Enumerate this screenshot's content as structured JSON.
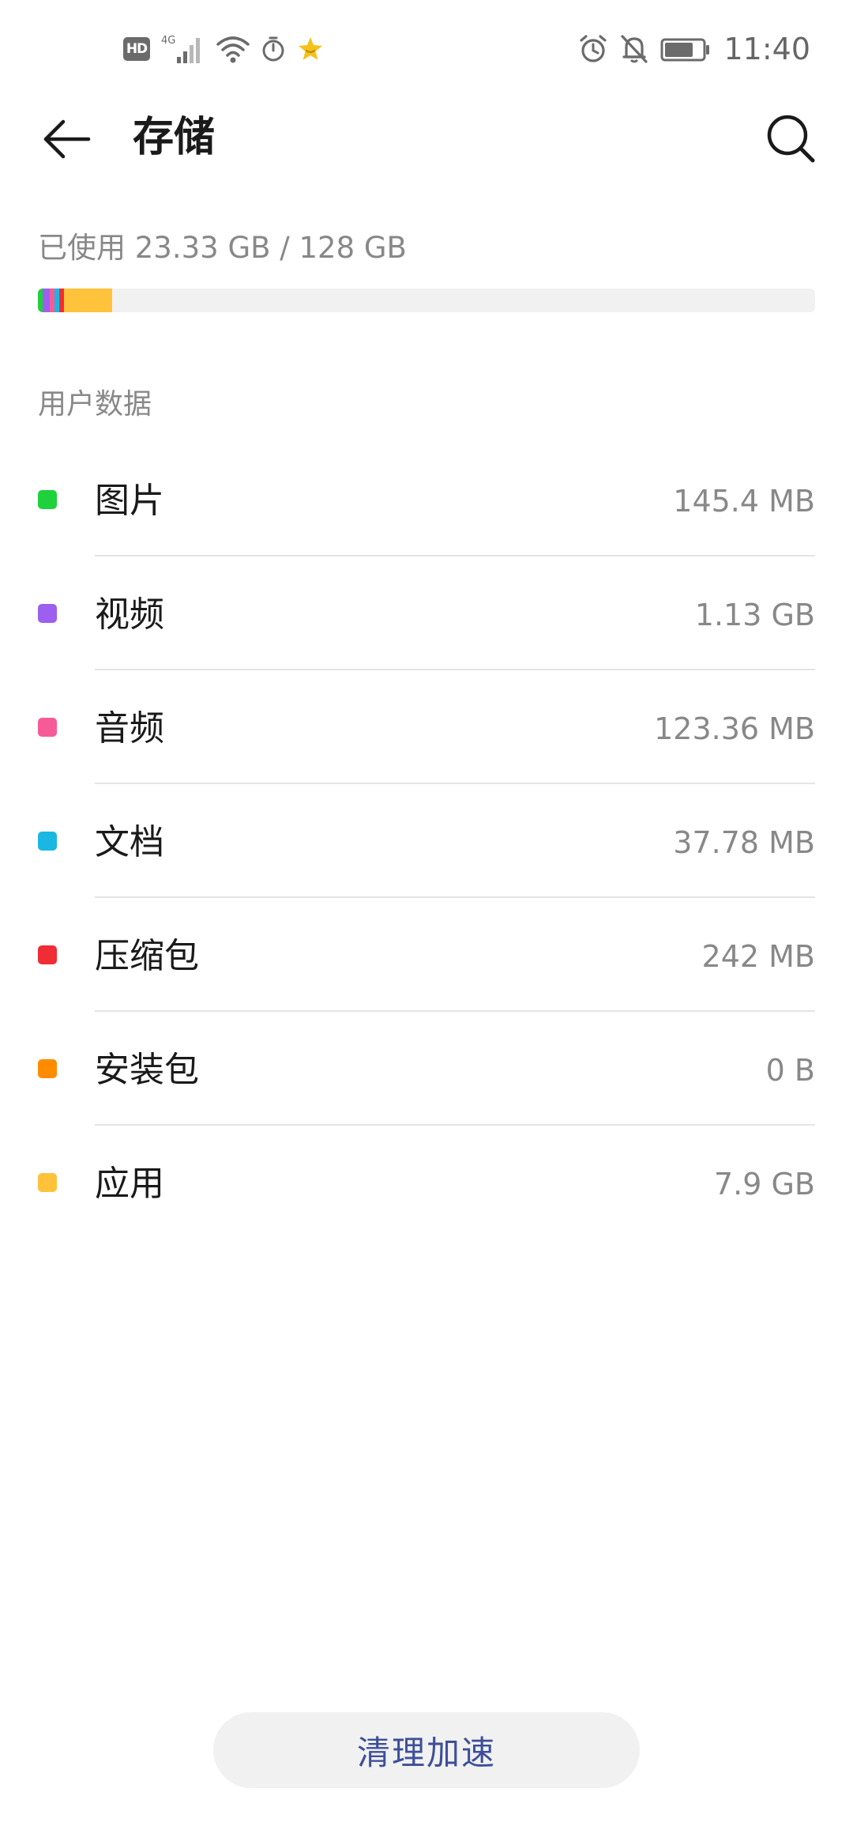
{
  "status_bar": {
    "hd_label": "HD",
    "network_label": "4G",
    "time": "11:40",
    "icons": [
      "hd-icon",
      "signal-icon",
      "wifi-icon",
      "timer-icon",
      "star-icon",
      "alarm-icon",
      "bell-off-icon",
      "battery-icon"
    ],
    "battery_level": 0.75
  },
  "app_bar": {
    "title": "存储",
    "back_icon": "back-arrow-icon",
    "search_icon": "search-icon"
  },
  "usage": {
    "text": "已使用 23.33 GB / 128 GB",
    "used_gb": 23.33,
    "total_gb": 128
  },
  "section": {
    "title": "用户数据"
  },
  "categories": [
    {
      "name": "图片",
      "size": "145.4 MB",
      "color": "#1fd13b"
    },
    {
      "name": "视频",
      "size": "1.13 GB",
      "color": "#9c5ff0"
    },
    {
      "name": "音频",
      "size": "123.36 MB",
      "color": "#f65b97"
    },
    {
      "name": "文档",
      "size": "37.78 MB",
      "color": "#1ab7e3"
    },
    {
      "name": "压缩包",
      "size": "242 MB",
      "color": "#f02c35"
    },
    {
      "name": "安装包",
      "size": "0 B",
      "color": "#ff8c00"
    },
    {
      "name": "应用",
      "size": "7.9 GB",
      "color": "#ffc23a"
    }
  ],
  "usage_segments": [
    {
      "name": "图片",
      "fraction": 0.0011,
      "color": "#1fd13b"
    },
    {
      "name": "视频",
      "fraction": 0.0088,
      "color": "#9c5ff0"
    },
    {
      "name": "音频",
      "fraction": 0.0009,
      "color": "#f65b97"
    },
    {
      "name": "文档",
      "fraction": 0.0003,
      "color": "#1ab7e3"
    },
    {
      "name": "压缩包",
      "fraction": 0.0019,
      "color": "#f02c35"
    },
    {
      "name": "安装包",
      "fraction": 0.0,
      "color": "#ff8c00"
    },
    {
      "name": "应用",
      "fraction": 0.0617,
      "color": "#ffc23a"
    }
  ],
  "actions": {
    "clean_label": "清理加速",
    "accent_color": "#3d4f99"
  }
}
